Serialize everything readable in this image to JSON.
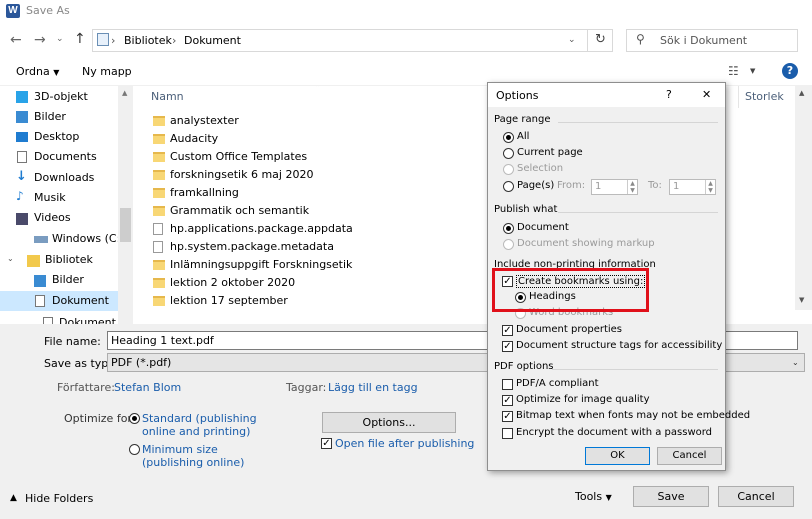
{
  "window": {
    "title": "Save As",
    "app_icon_letter": "W"
  },
  "nav": {
    "back_icon": "back-arrow-icon",
    "path": [
      "Bibliotek",
      "Dokument"
    ],
    "search_placeholder": "Sök i Dokument"
  },
  "toolbar": {
    "organize": "Ordna",
    "new_folder": "Ny mapp"
  },
  "sidebar": {
    "items": [
      {
        "label": "3D-objekt",
        "icon": "3d-objects-icon"
      },
      {
        "label": "Bilder",
        "icon": "pictures-icon"
      },
      {
        "label": "Desktop",
        "icon": "desktop-icon"
      },
      {
        "label": "Documents",
        "icon": "documents-icon"
      },
      {
        "label": "Downloads",
        "icon": "downloads-icon"
      },
      {
        "label": "Musik",
        "icon": "music-icon"
      },
      {
        "label": "Videos",
        "icon": "videos-icon"
      },
      {
        "label": "Windows (C:)",
        "icon": "drive-icon"
      },
      {
        "label": "Bibliotek",
        "icon": "library-icon"
      },
      {
        "label": "Bilder",
        "icon": "pictures-icon"
      },
      {
        "label": "Dokument",
        "icon": "documents-icon"
      },
      {
        "label": "Dokument",
        "icon": "documents-icon"
      }
    ]
  },
  "filelist": {
    "col_name": "Namn",
    "col_size": "Storlek",
    "files": [
      {
        "name": "analystexter",
        "type": "folder"
      },
      {
        "name": "Audacity",
        "type": "folder"
      },
      {
        "name": "Custom Office Templates",
        "type": "folder"
      },
      {
        "name": "forskningsetik 6 maj 2020",
        "type": "folder"
      },
      {
        "name": "framkallning",
        "type": "folder"
      },
      {
        "name": "Grammatik och semantik",
        "type": "folder"
      },
      {
        "name": "hp.applications.package.appdata",
        "type": "file"
      },
      {
        "name": "hp.system.package.metadata",
        "type": "file"
      },
      {
        "name": "Inlämningsuppgift Forskningsetik",
        "type": "folder"
      },
      {
        "name": "lektion 2 oktober 2020",
        "type": "folder"
      },
      {
        "name": "lektion 17 september",
        "type": "folder"
      }
    ]
  },
  "form": {
    "file_name_label": "File name:",
    "file_name_value": "Heading 1 text.pdf",
    "save_as_type_label": "Save as type:",
    "save_as_type_value": "PDF (*.pdf)",
    "author_label": "Författare:",
    "author_value": "Stefan Blom",
    "tags_label": "Taggar:",
    "tags_value": "Lägg till en tagg",
    "optimize_label": "Optimize for:",
    "optimize_standard": "Standard (publishing online and printing)",
    "optimize_standard_line1": "Standard (publishing",
    "optimize_standard_line2": "online and printing)",
    "optimize_minimum_line1": "Minimum size",
    "optimize_minimum_line2": "(publishing online)",
    "options_button": "Options...",
    "open_after": "Open file after publishing",
    "hide_folders": "Hide Folders",
    "tools": "Tools",
    "save": "Save",
    "cancel": "Cancel"
  },
  "options": {
    "title": "Options",
    "help": "?",
    "close": "✕",
    "page_range": {
      "header": "Page range",
      "all": "All",
      "current": "Current page",
      "selection": "Selection",
      "pages": "Page(s)",
      "from_label": "From:",
      "from_value": "1",
      "to_label": "To:",
      "to_value": "1"
    },
    "publish_what": {
      "header": "Publish what",
      "document": "Document",
      "markup": "Document showing markup"
    },
    "non_printing": {
      "header": "Include non-printing information",
      "bookmarks": "Create bookmarks using:",
      "headings": "Headings",
      "word_bookmarks": "Word bookmarks",
      "properties": "Document properties",
      "structure_tags": "Document structure tags for accessibility"
    },
    "pdf_options": {
      "header": "PDF options",
      "pdfa": "PDF/A compliant",
      "image_quality": "Optimize for image quality",
      "bitmap_text": "Bitmap text when fonts may not be embedded",
      "encrypt": "Encrypt the document with a password"
    },
    "ok": "OK",
    "cancel": "Cancel"
  },
  "accent_color": "#0078d7",
  "highlight_color": "#e0101a"
}
